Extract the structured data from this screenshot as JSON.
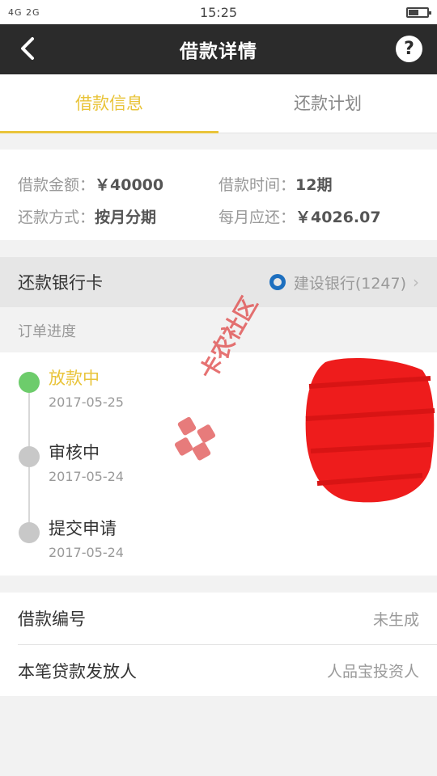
{
  "status_bar": {
    "signal": "4G 2G",
    "time": "15:25"
  },
  "nav": {
    "title": "借款详情",
    "help": "?"
  },
  "tabs": [
    {
      "label": "借款信息",
      "active": true
    },
    {
      "label": "还款计划",
      "active": false
    }
  ],
  "loan_info": {
    "amount_label": "借款金额：",
    "amount_value": "￥40000",
    "term_label": "借款时间：",
    "term_value": "12期",
    "method_label": "还款方式：",
    "method_value": "按月分期",
    "monthly_label": "每月应还：",
    "monthly_value": "￥4026.07"
  },
  "bank": {
    "label": "还款银行卡",
    "value": "建设银行(1247)",
    "chevron": "›"
  },
  "progress": {
    "heading": "订单进度",
    "steps": [
      {
        "status": "放款中",
        "date": "2017-05-25",
        "active": true
      },
      {
        "status": "审核中",
        "date": "2017-05-24",
        "active": false
      },
      {
        "status": "提交申请",
        "date": "2017-05-24",
        "active": false
      }
    ]
  },
  "details": {
    "loan_no_label": "借款编号",
    "loan_no_value": "未生成",
    "lender_label": "本笔贷款发放人",
    "lender_value": "人品宝投资人"
  },
  "watermark": {
    "text": "卡农社区"
  },
  "colors": {
    "accent": "#e9c43a",
    "active_dot": "#6dcc6b",
    "nav_bg": "#2b2b2b",
    "redaction": "#ee1c1c"
  }
}
